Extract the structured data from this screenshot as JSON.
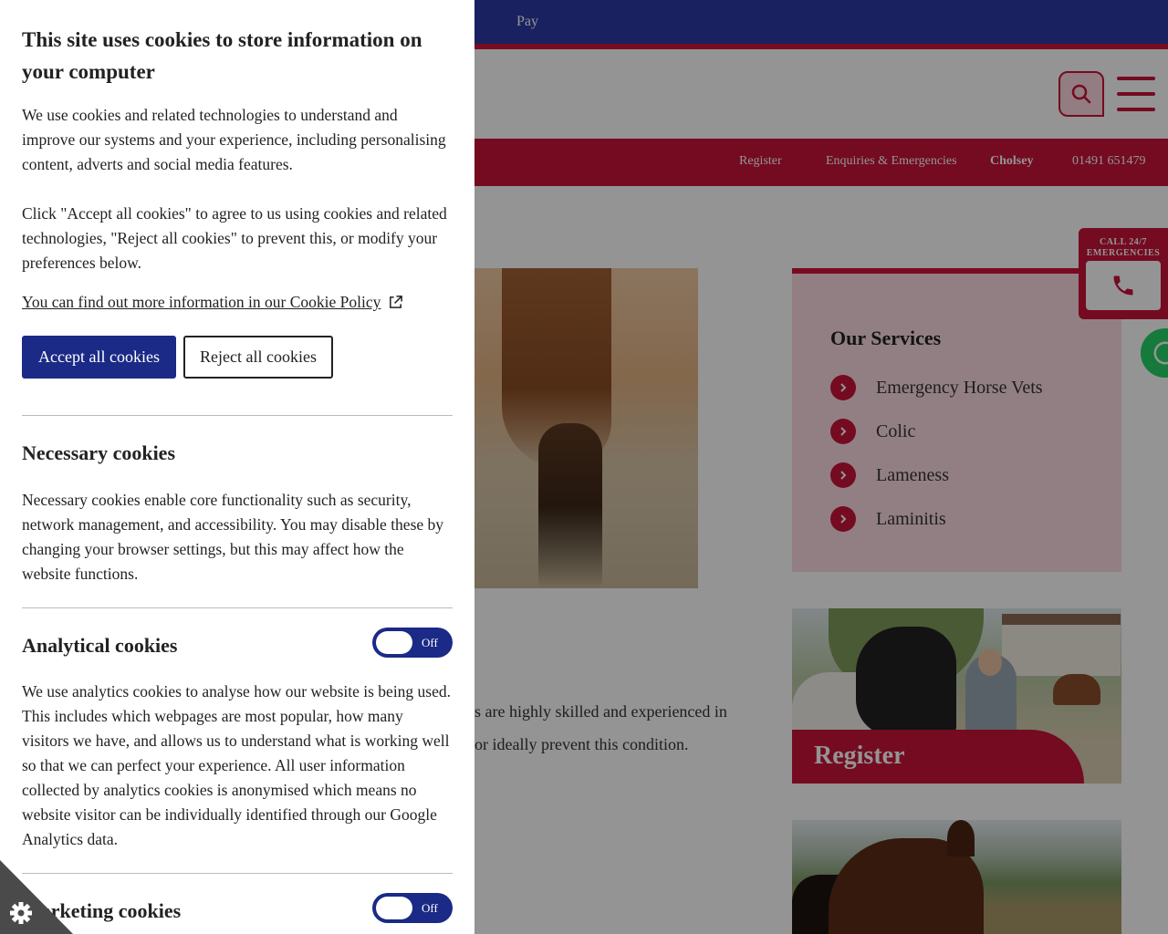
{
  "topbar": {
    "link": "Pay"
  },
  "nav": {
    "register": "Register",
    "enquiries": "Enquiries & Emergencies",
    "branch": "Cholsey",
    "phone": "01491 651479"
  },
  "content": {
    "line1": "s are highly skilled and experienced in",
    "line2": "or ideally prevent this condition."
  },
  "services": {
    "title": "Our Services",
    "items": [
      "Emergency Horse Vets",
      "Colic",
      "Lameness",
      "Laminitis"
    ]
  },
  "register_card": {
    "label": "Register"
  },
  "emergency_tab": {
    "line1": "CALL 24/7",
    "line2": "EMERGENCIES"
  },
  "cookie": {
    "title": "This site uses cookies to store information on your computer",
    "intro": "We use cookies and related technologies to understand and improve our systems and your experience, including personalising content, adverts and social media features.",
    "instructions": "Click \"Accept all cookies\" to agree to us using cookies and related technologies, \"Reject all cookies\" to prevent this, or modify your preferences below.",
    "policy_link": "You can find out more information in our Cookie Policy",
    "accept_label": "Accept all cookies",
    "reject_label": "Reject all cookies",
    "necessary": {
      "title": "Necessary cookies",
      "text": "Necessary cookies enable core functionality such as security, network management, and accessibility. You may disable these by changing your browser settings, but this may affect how the website functions."
    },
    "analytical": {
      "title": "Analytical cookies",
      "toggle": "Off",
      "text": "We use analytics cookies to analyse how our website is being used. This includes which webpages are most popular, how many visitors we have, and allows us to understand what is working well so that we can perfect your experience. All user information collected by analytics cookies is anonymised which means no website visitor can be individually identified through our Google Analytics data."
    },
    "marketing": {
      "title": "Marketing cookies",
      "toggle": "Off"
    }
  },
  "colors": {
    "brand_red": "#c8143a",
    "brand_blue": "#1b2a86",
    "topbar_blue": "#2b3aa6",
    "services_pink": "#fbdbe2"
  },
  "icons": [
    "search-icon",
    "menu-icon",
    "phone-icon",
    "chevron-right-icon",
    "external-link-icon",
    "gear-icon",
    "whatsapp-icon"
  ]
}
